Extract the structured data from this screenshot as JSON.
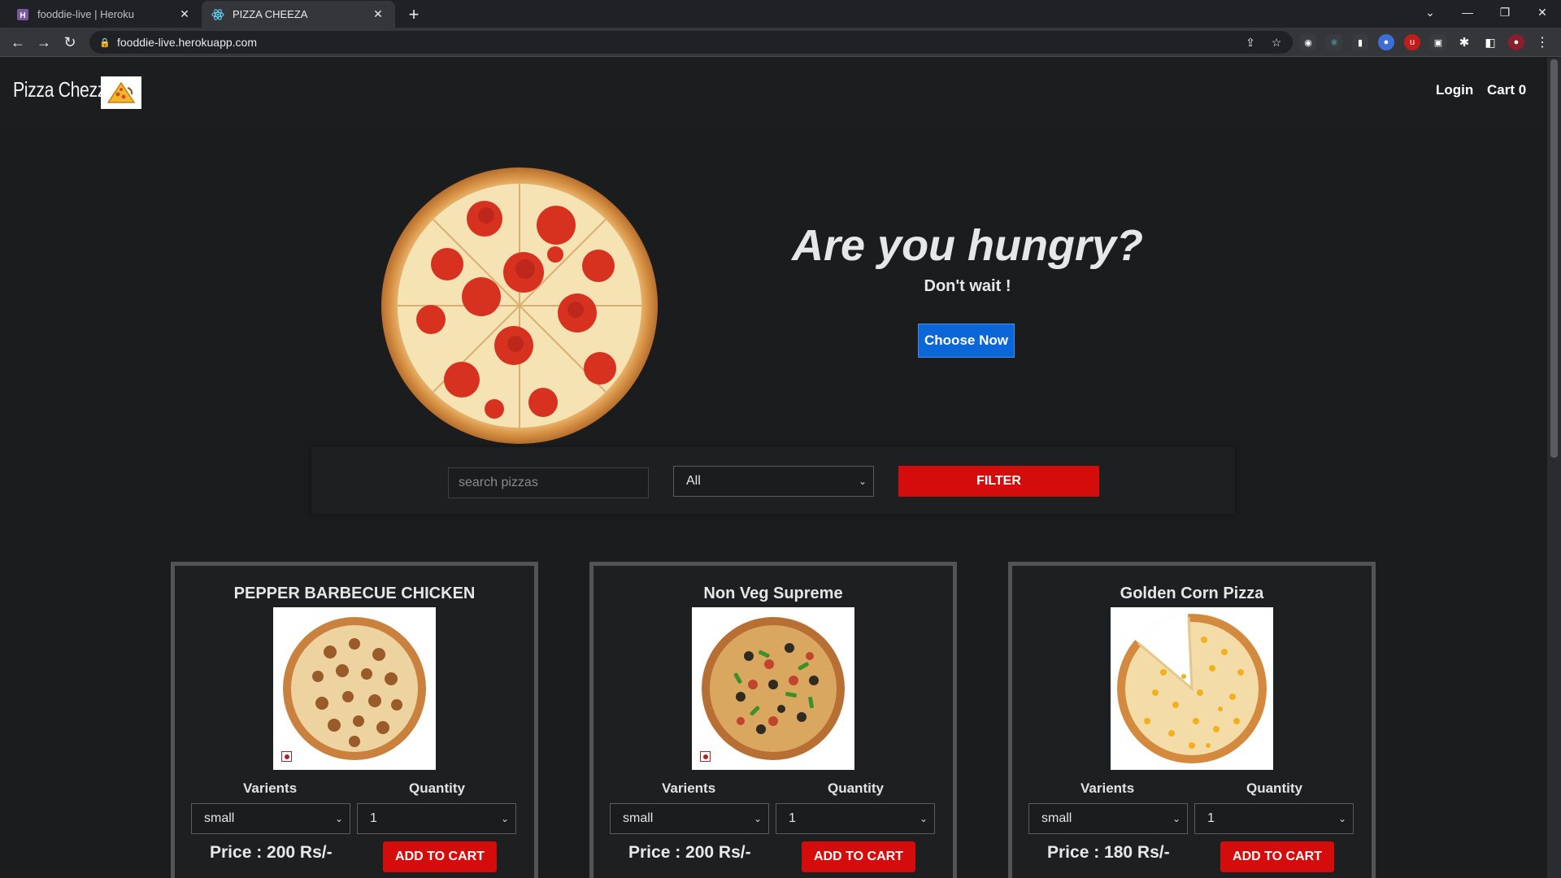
{
  "browser": {
    "tabs": [
      {
        "title": "fooddie-live | Heroku",
        "favicon": "heroku-icon",
        "active": false
      },
      {
        "title": "PIZZA CHEEZA",
        "favicon": "react-icon",
        "active": true
      }
    ],
    "url": "fooddie-live.herokuapp.com"
  },
  "navbar": {
    "brand": "Pizza Chezza",
    "login": "Login",
    "cart": "Cart 0"
  },
  "hero": {
    "title": "Are you hungry?",
    "subtitle": "Don't wait !",
    "cta": "Choose Now"
  },
  "filter": {
    "search_placeholder": "search pizzas",
    "category_selected": "All",
    "button": "FILTER"
  },
  "pizzas": [
    {
      "name": "PEPPER BARBECUE CHICKEN",
      "variants_label": "Varients",
      "quantity_label": "Quantity",
      "variant": "small",
      "quantity": "1",
      "price": "Price : 200 Rs/-",
      "add_label": "ADD TO CART",
      "nonveg": true
    },
    {
      "name": "Non Veg Supreme",
      "variants_label": "Varients",
      "quantity_label": "Quantity",
      "variant": "small",
      "quantity": "1",
      "price": "Price : 200 Rs/-",
      "add_label": "ADD TO CART",
      "nonveg": true
    },
    {
      "name": "Golden Corn Pizza",
      "variants_label": "Varients",
      "quantity_label": "Quantity",
      "variant": "small",
      "quantity": "1",
      "price": "Price : 180 Rs/-",
      "add_label": "ADD TO CART",
      "nonveg": false
    }
  ],
  "colors": {
    "accent_red": "#d40c0c",
    "accent_blue": "#0b66d8",
    "background": "#1b1c1e"
  }
}
